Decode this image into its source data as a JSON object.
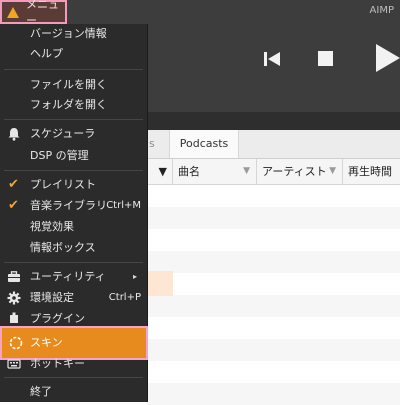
{
  "app": {
    "brand": "AIMP",
    "menu_button_label": "メニュー"
  },
  "tabs": {
    "inactive_fragment": "s",
    "active": "Podcasts"
  },
  "columns": {
    "pre_arrow": "▼",
    "title": "曲名",
    "artist": "アーティスト",
    "duration": "再生時間"
  },
  "menu": {
    "version": "バージョン情報",
    "help": "ヘルプ",
    "open_file": "ファイルを開く",
    "open_folder": "フォルダを開く",
    "scheduler": "スケジューラ",
    "dsp": "DSP の管理",
    "playlist": "プレイリスト",
    "library": "音楽ライブラリ",
    "library_shortcut": "Ctrl+M",
    "visual": "視覚効果",
    "infobox": "情報ボックス",
    "utility": "ユーティリティ",
    "utility_arrow": "▸",
    "settings": "環境設定",
    "settings_shortcut": "Ctrl+P",
    "plugins": "プラグイン",
    "skin": "スキン",
    "hotkeys": "ホットキー",
    "exit": "終了"
  },
  "colors": {
    "accent": "#e78b1e",
    "highlight_border": "#f5a3c6",
    "menu_bg": "#2b2b2b",
    "player_bg": "#3d3d3d"
  }
}
